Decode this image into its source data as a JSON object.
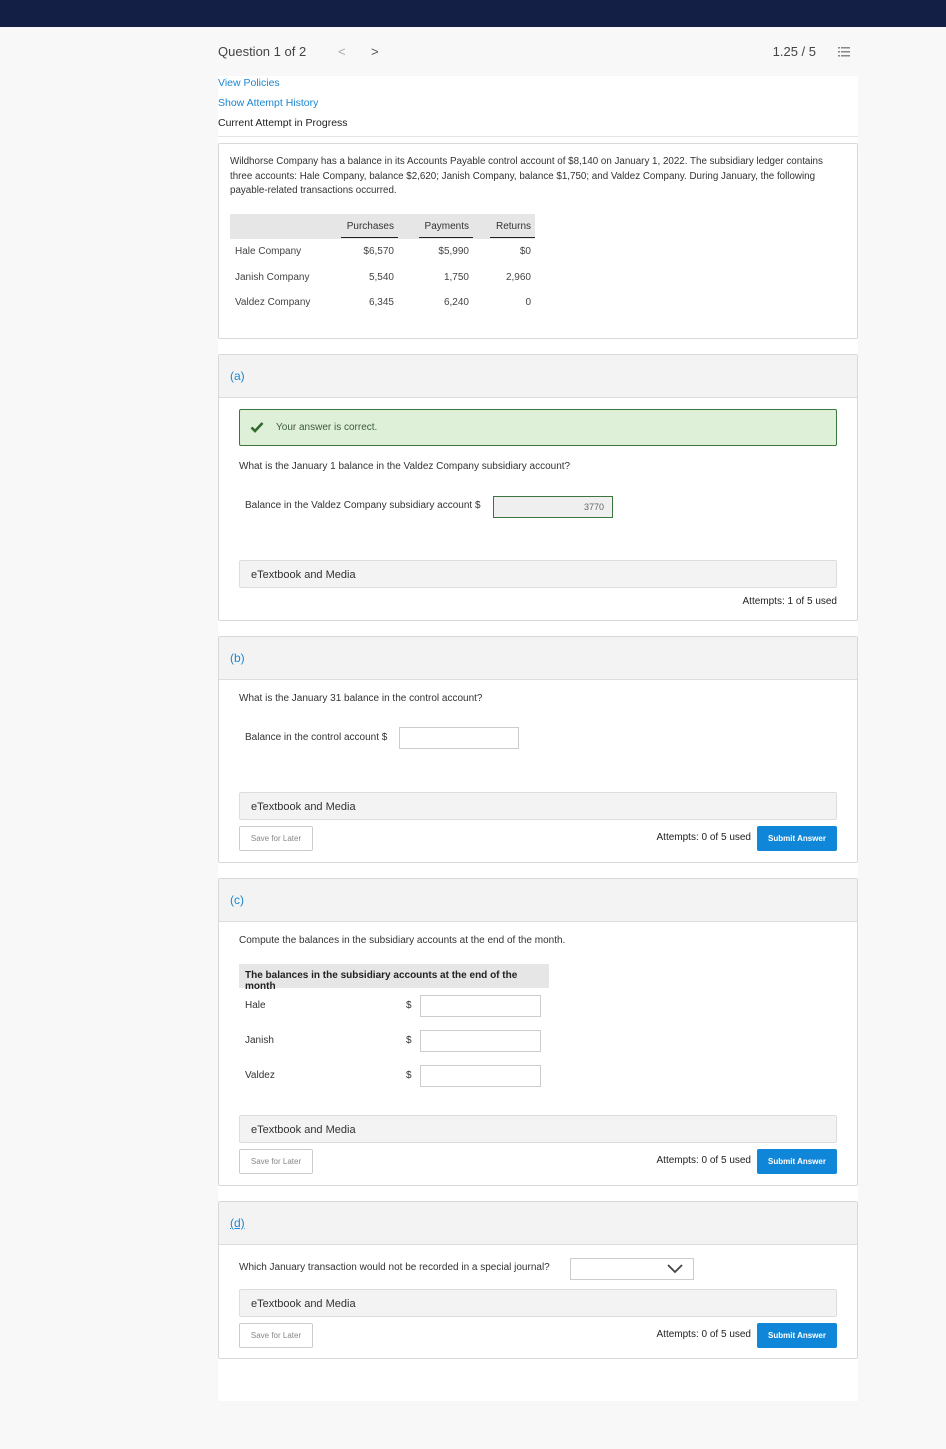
{
  "header": {
    "question_label": "Question 1 of 2",
    "prev_glyph": "<",
    "next_glyph": ">",
    "score": "1.25 / 5"
  },
  "links": {
    "view_policies": "View Policies",
    "show_attempt_history": "Show Attempt History",
    "status": "Current Attempt in Progress"
  },
  "problem": {
    "text": "Wildhorse Company has a balance in its Accounts Payable control account of $8,140 on January 1, 2022. The subsidiary ledger contains three accounts: Hale Company, balance $2,620; Janish Company, balance $1,750; and Valdez Company. During January, the following payable-related transactions occurred.",
    "table": {
      "columns": [
        "Purchases",
        "Payments",
        "Returns"
      ],
      "rows": [
        {
          "name": "Hale Company",
          "values": [
            "$6,570",
            "$5,990",
            "$0"
          ]
        },
        {
          "name": "Janish Company",
          "values": [
            "5,540",
            "1,750",
            "2,960"
          ]
        },
        {
          "name": "Valdez Company",
          "values": [
            "6,345",
            "6,240",
            "0"
          ]
        }
      ]
    }
  },
  "common": {
    "etextbook": "eTextbook and Media",
    "save_for_later": "Save for Later",
    "submit_answer": "Submit Answer",
    "currency": "$"
  },
  "parts": {
    "a": {
      "label": "(a)",
      "feedback": "Your answer is correct.",
      "question": "What is the January 1 balance in the Valdez Company subsidiary account?",
      "field_label": "Balance in the Valdez Company subsidiary account $",
      "field_value": "3770",
      "attempts": "Attempts: 1 of 5 used"
    },
    "b": {
      "label": "(b)",
      "question": "What is the January 31 balance in the control account?",
      "field_label": "Balance in the control account $",
      "field_value": "",
      "attempts": "Attempts: 0 of 5 used"
    },
    "c": {
      "label": "(c)",
      "question": "Compute the balances in the subsidiary accounts at the end of the month.",
      "table_header": "The balances in the subsidiary accounts at the end of the month",
      "rows": [
        {
          "name": "Hale",
          "value": ""
        },
        {
          "name": "Janish",
          "value": ""
        },
        {
          "name": "Valdez",
          "value": ""
        }
      ],
      "attempts": "Attempts: 0 of 5 used"
    },
    "d": {
      "label": "(d)",
      "question": "Which January transaction would not be recorded in a special journal?",
      "selected": "",
      "attempts": "Attempts: 0 of 5 used"
    }
  },
  "colors": {
    "topbar": "#131f45",
    "link": "#1a87d2",
    "submit": "#0f86d8",
    "correct_bg": "#dff0d8",
    "correct_border": "#3c763d"
  }
}
